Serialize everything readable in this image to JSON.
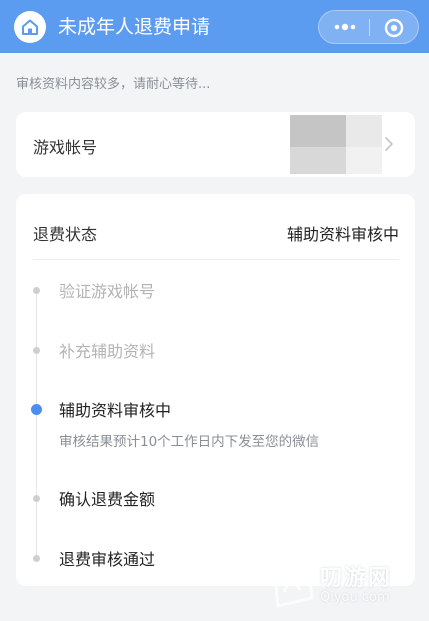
{
  "header": {
    "title": "未成年人退费申请",
    "home_icon": "home-icon",
    "more_icon": "more-dots-icon",
    "close_icon": "target-close-icon",
    "bar_color": "#5b9cf0"
  },
  "hint": "审核资料内容较多，请耐心等待...",
  "account": {
    "label": "游戏帐号",
    "chevron_icon": "chevron-right-icon"
  },
  "status": {
    "label": "退费状态",
    "value": "辅助资料审核中",
    "steps": [
      {
        "label": "验证游戏帐号",
        "state": "done"
      },
      {
        "label": "补充辅助资料",
        "state": "done"
      },
      {
        "label": "辅助资料审核中",
        "state": "current",
        "sub": "审核结果预计10个工作日内下发至您的微信"
      },
      {
        "label": "确认退费金额",
        "state": "pending"
      },
      {
        "label": "退费审核通过",
        "state": "pending"
      }
    ],
    "active_color": "#4a8ef0"
  },
  "watermark": {
    "text": "叨游网",
    "url": "Qiyou.com"
  }
}
